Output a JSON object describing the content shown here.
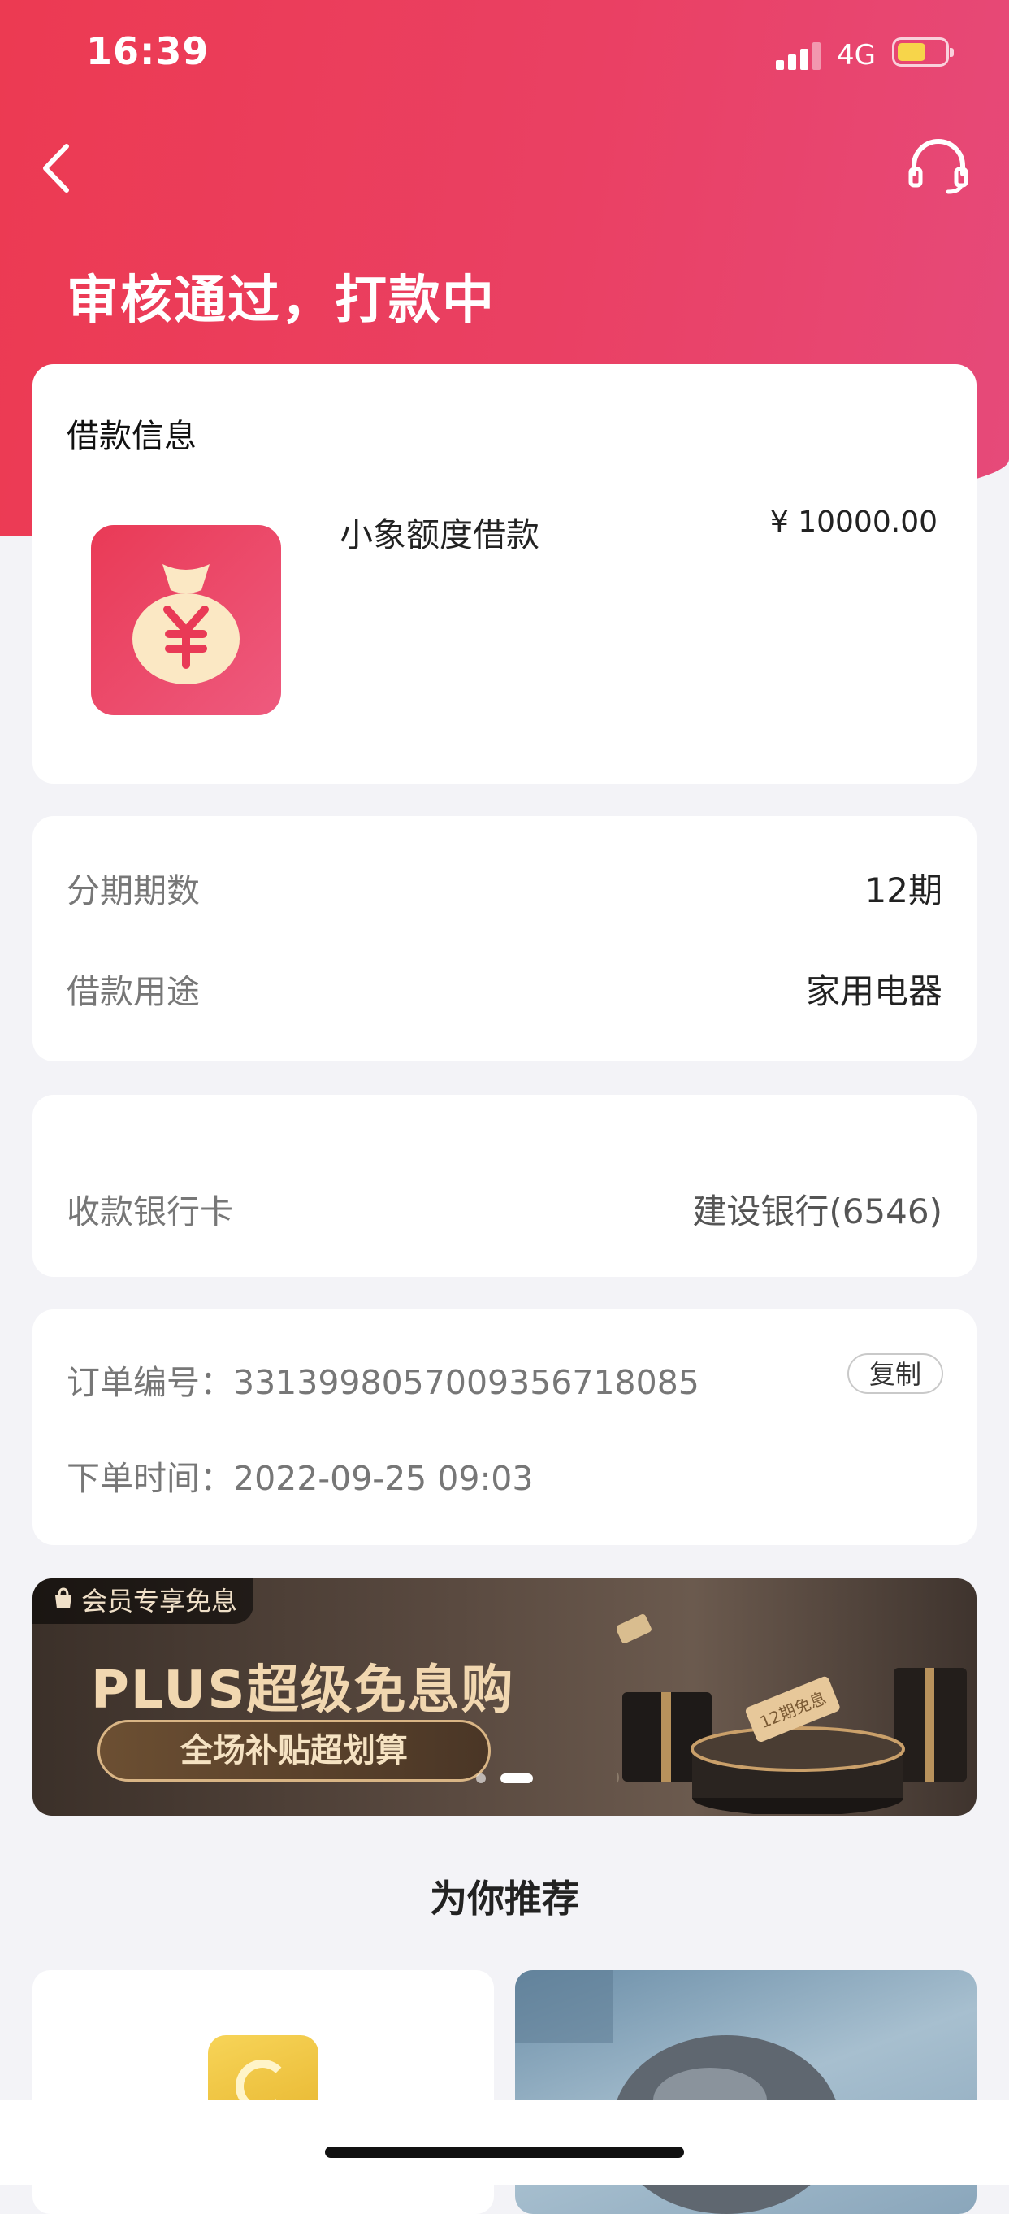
{
  "status_bar": {
    "time": "16:39",
    "network": "4G"
  },
  "header": {
    "title": "审核通过，打款中",
    "back_icon": "chevron-left-icon",
    "support_icon": "headset-icon"
  },
  "loan_info": {
    "section_title": "借款信息",
    "product_name": "小象额度借款",
    "amount": "¥ 10000.00",
    "icon": "money-bag-icon"
  },
  "terms": {
    "rows": [
      {
        "label": "分期期数",
        "value": "12期"
      },
      {
        "label": "借款用途",
        "value": "家用电器"
      }
    ]
  },
  "bank": {
    "label": "收款银行卡",
    "value": "建设银行(6546)"
  },
  "order": {
    "number_label": "订单编号：",
    "number": "3313998057009356718085",
    "copy_label": "复制",
    "time_label": "下单时间：",
    "time": "2022-09-25 09:03"
  },
  "banner": {
    "tag": "会员专享免息",
    "title": "PLUS超级免息购",
    "subtitle": "全场补贴超划算",
    "ticket_text": "12期免息",
    "active_slide": 2,
    "total_slides": 2
  },
  "recommend": {
    "title": "为你推荐"
  },
  "colors": {
    "accent": "#ec3a52",
    "background": "#f3f3f7",
    "banner_gold": "#f1d7b0"
  }
}
